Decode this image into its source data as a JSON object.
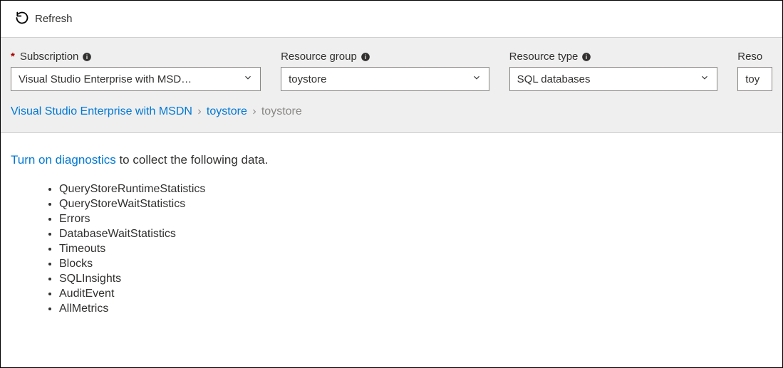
{
  "toolbar": {
    "refresh_label": "Refresh"
  },
  "filters": {
    "subscription": {
      "label": "Subscription",
      "required": true,
      "value": "Visual Studio Enterprise with MSD…"
    },
    "resource_group": {
      "label": "Resource group",
      "value": "toystore"
    },
    "resource_type": {
      "label": "Resource type",
      "value": "SQL databases"
    },
    "resource": {
      "label": "Reso",
      "value": "toy"
    }
  },
  "breadcrumb": {
    "items": [
      {
        "label": "Visual Studio Enterprise with MSDN",
        "current": false
      },
      {
        "label": "toystore",
        "current": false
      },
      {
        "label": "toystore",
        "current": true
      }
    ]
  },
  "content": {
    "diagnostics_link": "Turn on diagnostics",
    "diagnostics_suffix": " to collect the following data.",
    "items": [
      "QueryStoreRuntimeStatistics",
      "QueryStoreWaitStatistics",
      "Errors",
      "DatabaseWaitStatistics",
      "Timeouts",
      "Blocks",
      "SQLInsights",
      "AuditEvent",
      "AllMetrics"
    ]
  }
}
